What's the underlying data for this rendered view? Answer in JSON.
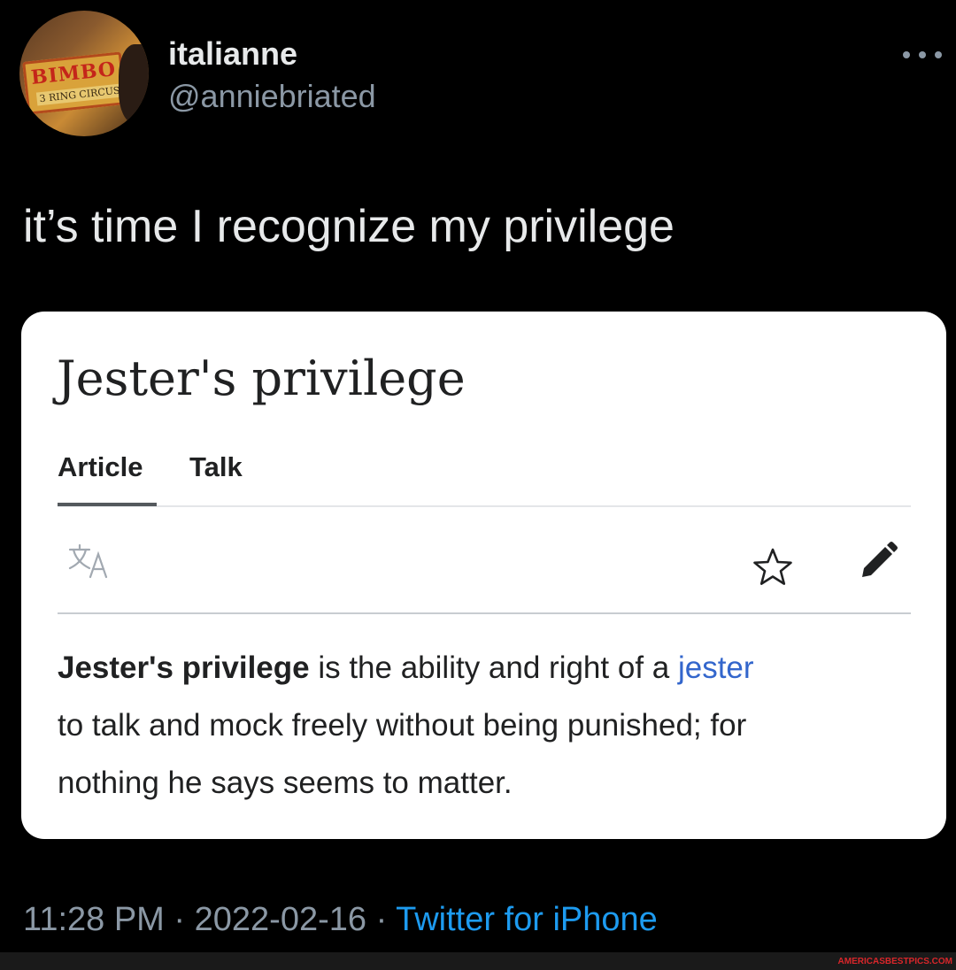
{
  "tweet": {
    "display_name": "italianne",
    "handle": "@anniebriated",
    "avatar_text_top": "BIMBO",
    "avatar_text_bottom": "3 RING CIRCUS",
    "text": "it’s time I recognize my privilege",
    "time": "11:28 PM",
    "date": "2022-02-16",
    "separator": " · ",
    "source": "Twitter for iPhone"
  },
  "card": {
    "title": "Jester's privilege",
    "tabs": [
      {
        "label": "Article",
        "active": true
      },
      {
        "label": "Talk",
        "active": false
      }
    ],
    "tool_icons": [
      "translate-icon",
      "star-icon",
      "edit-icon"
    ],
    "body": {
      "term": "Jester's privilege",
      "text_before_link": " is the ability and right of a ",
      "link_text": "jester",
      "line2": "to talk and mock freely without being punished; for",
      "line3": "nothing he says seems to matter."
    },
    "link_color": "#3366cc"
  },
  "watermark": "AMERICASBESTPICS.COM",
  "colors": {
    "background": "#000000",
    "primary_text": "#e7e9ea",
    "secondary_text": "#8b98a5",
    "accent": "#1d9bf0"
  }
}
